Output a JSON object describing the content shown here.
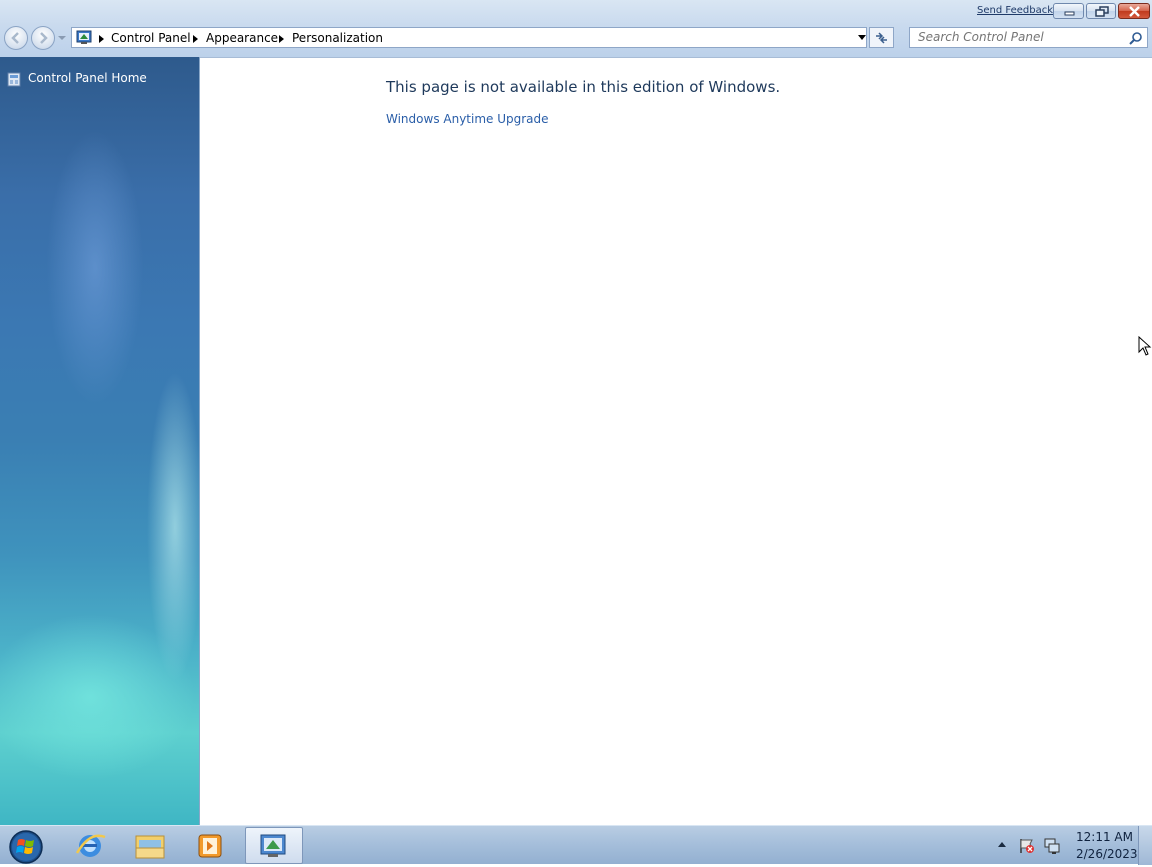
{
  "window": {
    "send_feedback": "Send Feedback"
  },
  "address": {
    "crumbs": [
      "Control Panel",
      "Appearance",
      "Personalization"
    ]
  },
  "search": {
    "placeholder": "Search Control Panel"
  },
  "left_pane": {
    "home_label": "Control Panel Home"
  },
  "main": {
    "message": "This page is not available in this edition of Windows.",
    "upgrade_link": "Windows Anytime Upgrade"
  },
  "taskbar": {
    "time": "12:11 AM",
    "date": "2/26/2023",
    "pinned": [
      "internet-explorer-icon",
      "windows-explorer-icon",
      "media-player-icon",
      "control-panel-icon"
    ]
  },
  "colors": {
    "message_text": "#1e395b",
    "link_text": "#2a5ea8",
    "pane_top": "#2e5a8c",
    "pane_bottom": "#3fb6c4"
  }
}
